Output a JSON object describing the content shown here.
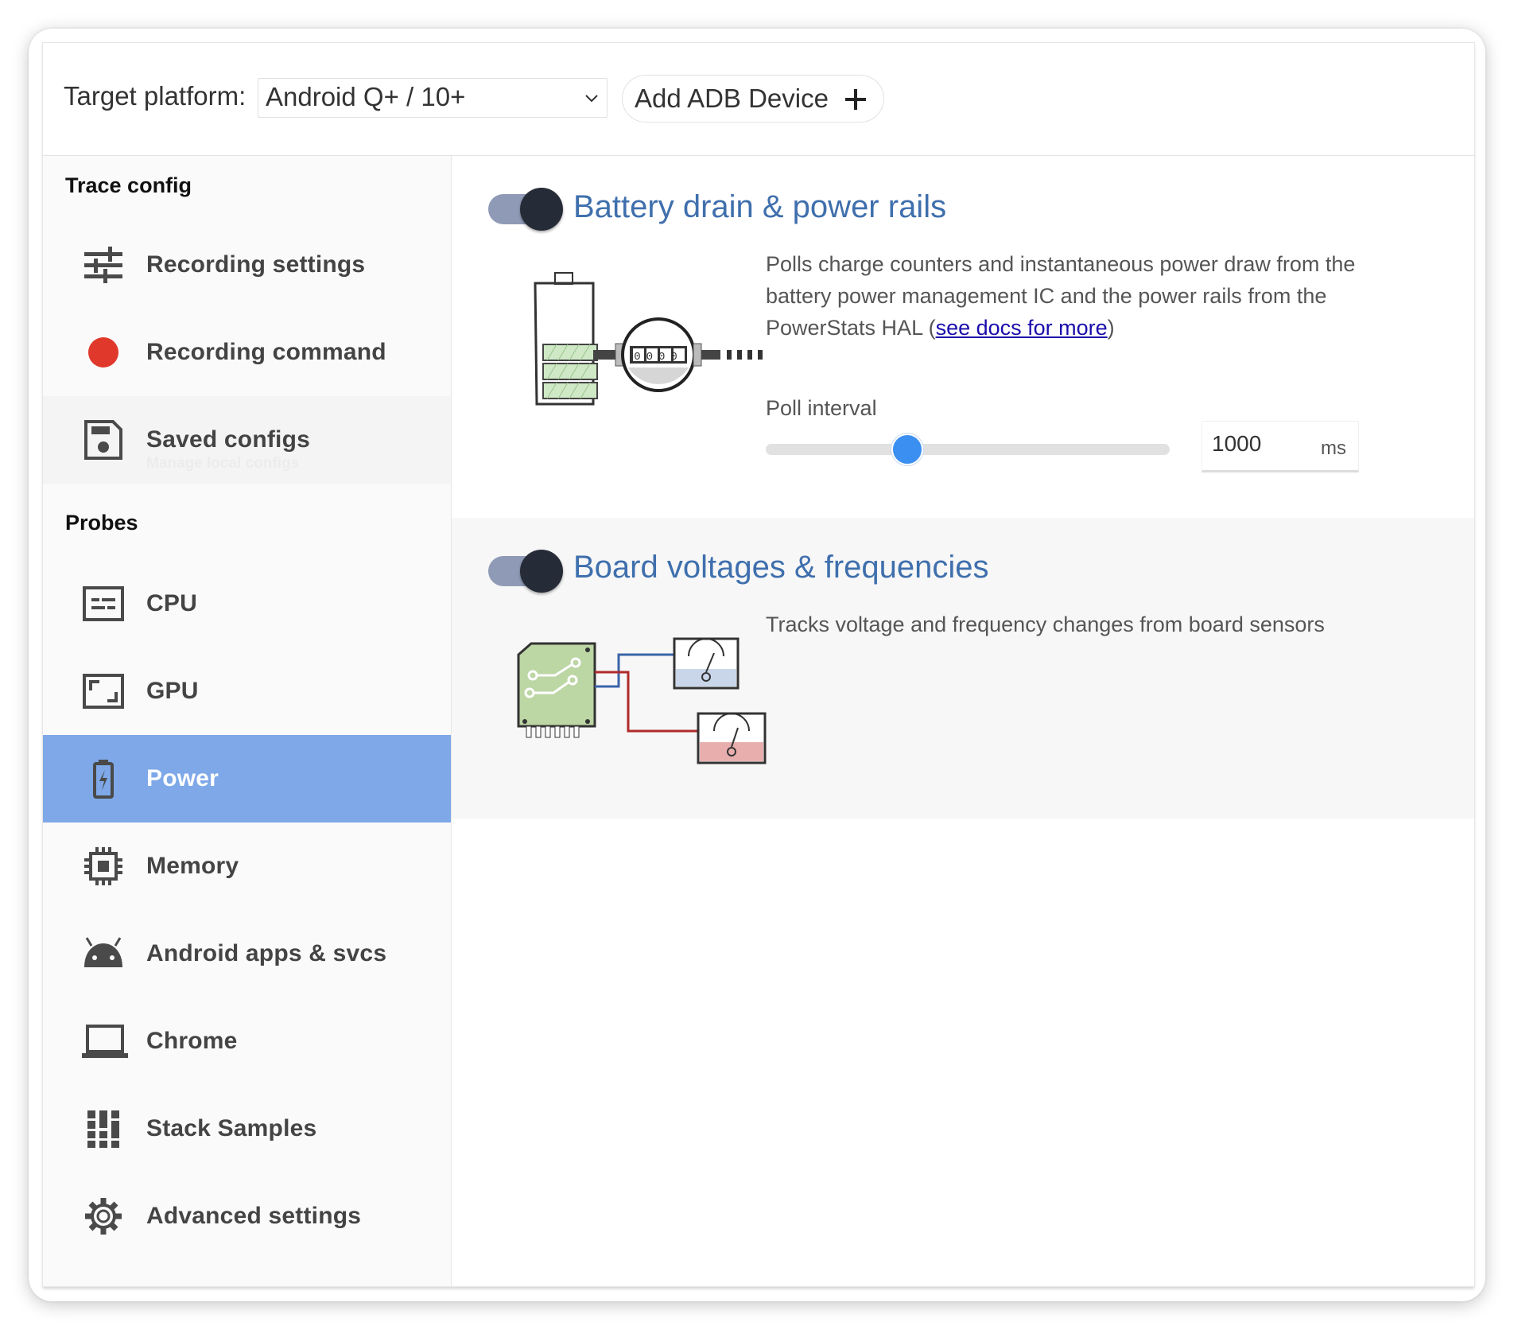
{
  "header": {
    "target_label": "Target platform:",
    "platform_value": "Android Q+ / 10+",
    "add_device_label": "Add ADB Device"
  },
  "sidebar": {
    "trace_config_title": "Trace config",
    "probes_title": "Probes",
    "trace_items": [
      {
        "label": "Recording settings",
        "icon": "sliders-icon"
      },
      {
        "label": "Recording command",
        "icon": "record-dot-icon"
      },
      {
        "label": "Saved configs",
        "sublabel": "Manage local configs",
        "icon": "floppy-disk-icon"
      }
    ],
    "probe_items": [
      {
        "label": "CPU",
        "icon": "cpu-icon"
      },
      {
        "label": "GPU",
        "icon": "gpu-icon"
      },
      {
        "label": "Power",
        "icon": "battery-charging-icon",
        "active": true
      },
      {
        "label": "Memory",
        "icon": "memory-chip-icon"
      },
      {
        "label": "Android apps & svcs",
        "icon": "android-icon"
      },
      {
        "label": "Chrome",
        "icon": "laptop-icon"
      },
      {
        "label": "Stack Samples",
        "icon": "stack-samples-icon"
      },
      {
        "label": "Advanced settings",
        "icon": "gear-icon"
      }
    ]
  },
  "probes": [
    {
      "title": "Battery drain & power rails",
      "enabled": true,
      "description_before_link": "Polls charge counters and instantaneous power draw from the battery power management IC and the power rails from the PowerStats HAL (",
      "link_text": "see docs for more",
      "description_after_link": ")",
      "meter_digits": "0000",
      "poll": {
        "label": "Poll interval",
        "value": "1000",
        "unit": "ms",
        "slider_fraction": 0.35
      }
    },
    {
      "title": "Board voltages & frequencies",
      "enabled": true,
      "description": "Tracks voltage and frequency changes from board sensors"
    }
  ],
  "colors": {
    "accent_blue": "#3f6fad",
    "active_item": "#7ea8e8",
    "record_red": "#e0392b",
    "slider_blue": "#3b8ff0"
  }
}
